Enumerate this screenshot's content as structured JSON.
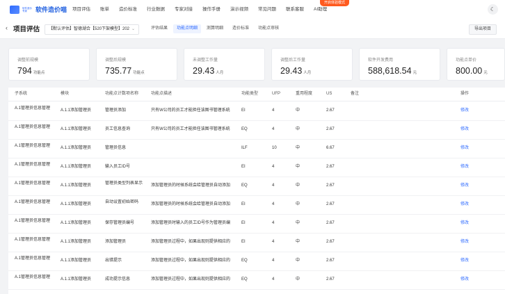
{
  "app": {
    "logo_sub": "软件造价 专家",
    "logo_text": "软件造价喵",
    "promo": "开启体验模式",
    "theme_icon": "moon-icon"
  },
  "nav": [
    "项目评估",
    "账单",
    "造价标准",
    "行业数据",
    "专家对接",
    "操作手册",
    "演示视频",
    "常见问题",
    "联系客服",
    "AI助理"
  ],
  "toolbar": {
    "back_icon": "chevron-left-icon",
    "title": "项目评估",
    "project": "【默认评估】智德湖合【520下架模型】202",
    "tabs": [
      "评估结果",
      "功能点明细",
      "测算明细",
      "造价标准",
      "功能点审核"
    ],
    "active_tab": 1,
    "export_label": "导出项目"
  },
  "cards": [
    {
      "label": "调整前规模",
      "value": "794",
      "unit": "功能点"
    },
    {
      "label": "调整后规模",
      "value": "735.77",
      "unit": "功能点"
    },
    {
      "label": "未调整工作量",
      "value": "29.43",
      "unit": "人月"
    },
    {
      "label": "调整后工作量",
      "value": "29.43",
      "unit": "人月"
    },
    {
      "label": "软件开发费用",
      "value": "588,618.54",
      "unit": "元"
    },
    {
      "label": "功能点单价",
      "value": "800.00",
      "unit": "元"
    }
  ],
  "table": {
    "columns": [
      "子系统",
      "模块",
      "功能点计数项名称",
      "功能点描述",
      "功能类型",
      "UFP",
      "重用程度",
      "US",
      "备注",
      "操作"
    ],
    "rows": [
      [
        "A.1管理员信息管理",
        "A.1.1添加管理员",
        "管理员添加",
        "只有W公司的员工才能担任该图书管理系统",
        "EI",
        "4",
        "中",
        "2.67",
        "",
        "修改"
      ],
      [
        "A.1管理员信息管理",
        "A.1.1添加管理员",
        "员工信息查询",
        "只有W公司的员工才能担任该图书管理系统",
        "EQ",
        "4",
        "中",
        "2.67",
        "",
        "修改"
      ],
      [
        "A.1管理员信息管理",
        "A.1.1添加管理员",
        "管理员信息",
        "",
        "ILF",
        "10",
        "中",
        "6.67",
        "",
        "修改"
      ],
      [
        "A.1管理员信息管理",
        "A.1.1添加管理员",
        "输入员工ID号",
        "",
        "EI",
        "4",
        "中",
        "2.67",
        "",
        "修改"
      ],
      [
        "A.1管理员信息管理",
        "A.1.1添加管理员",
        "管理员类型列表显示",
        "添加管理员的时候系统会给管理员自动添加",
        "EQ",
        "4",
        "中",
        "2.67",
        "",
        "修改"
      ],
      [
        "A.1管理员信息管理",
        "A.1.1添加管理员",
        "自动设置初始密码",
        "添加管理员的时候系统会给管理员自动添加",
        "EI",
        "4",
        "中",
        "2.67",
        "",
        "修改"
      ],
      [
        "A.1管理员信息管理",
        "A.1.1添加管理员",
        "保存管理员编号",
        "添加管理员时输入的员工ID号作为管理员编",
        "EI",
        "4",
        "中",
        "2.67",
        "",
        "修改"
      ],
      [
        "A.1管理员信息管理",
        "A.1.1添加管理员",
        "添加管理员",
        "添加管理员过程中，如果出现则提供相应的",
        "EI",
        "4",
        "中",
        "2.67",
        "",
        "修改"
      ],
      [
        "A.1管理员信息管理",
        "A.1.1添加管理员",
        "出错提示",
        "添加管理员过程中，如果出现则提供相应的",
        "EQ",
        "4",
        "中",
        "2.67",
        "",
        "修改"
      ],
      [
        "A.1管理员信息管理",
        "A.1.1添加管理员",
        "成功提示信息",
        "添加管理员过程中，如果出现则提供相应的",
        "EQ",
        "4",
        "中",
        "2.67",
        "",
        "修改"
      ]
    ]
  }
}
